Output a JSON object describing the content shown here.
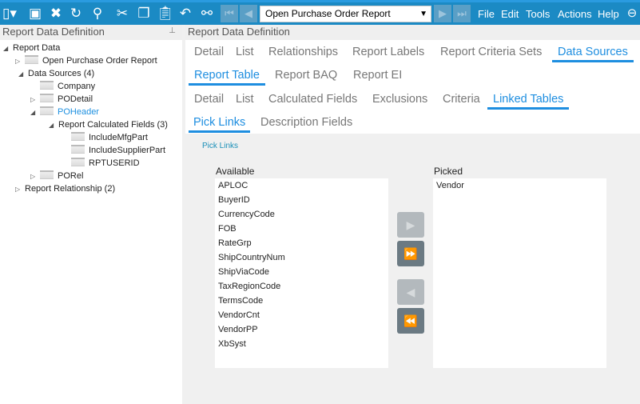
{
  "toolbar": {
    "report_select": "Open Purchase Order Report",
    "menu": [
      "File",
      "Edit",
      "Tools",
      "Actions",
      "Help"
    ]
  },
  "left_panel": {
    "title": "Report Data Definition",
    "tree": [
      {
        "label": "Report Data"
      },
      {
        "label": "Open Purchase Order Report"
      },
      {
        "label": "Data Sources (4)"
      },
      {
        "label": "Company"
      },
      {
        "label": "PODetail"
      },
      {
        "label": "POHeader"
      },
      {
        "label": "Report Calculated Fields (3)"
      },
      {
        "label": "IncludeMfgPart"
      },
      {
        "label": "IncludeSupplierPart"
      },
      {
        "label": "RPTUSERID"
      },
      {
        "label": "PORel"
      },
      {
        "label": "Report Relationship (2)"
      }
    ]
  },
  "right_panel": {
    "title": "Report Data Definition",
    "tabs1": [
      "Detail",
      "List",
      "Relationships",
      "Report Labels",
      "Report Criteria Sets",
      "Data Sources"
    ],
    "tabs2": [
      "Report Table",
      "Report BAQ",
      "Report EI"
    ],
    "tabs3": [
      "Detail",
      "List",
      "Calculated Fields",
      "Exclusions",
      "Criteria",
      "Linked Tables"
    ],
    "tabs4": [
      "Pick Links",
      "Description Fields"
    ],
    "section_title": "Pick Links",
    "available_label": "Available",
    "picked_label": "Picked",
    "available": [
      "APLOC",
      "BuyerID",
      "CurrencyCode",
      "FOB",
      "RateGrp",
      "ShipCountryNum",
      "ShipViaCode",
      "TaxRegionCode",
      "TermsCode",
      "VendorCnt",
      "VendorPP",
      "XbSyst"
    ],
    "picked": [
      "Vendor"
    ]
  }
}
